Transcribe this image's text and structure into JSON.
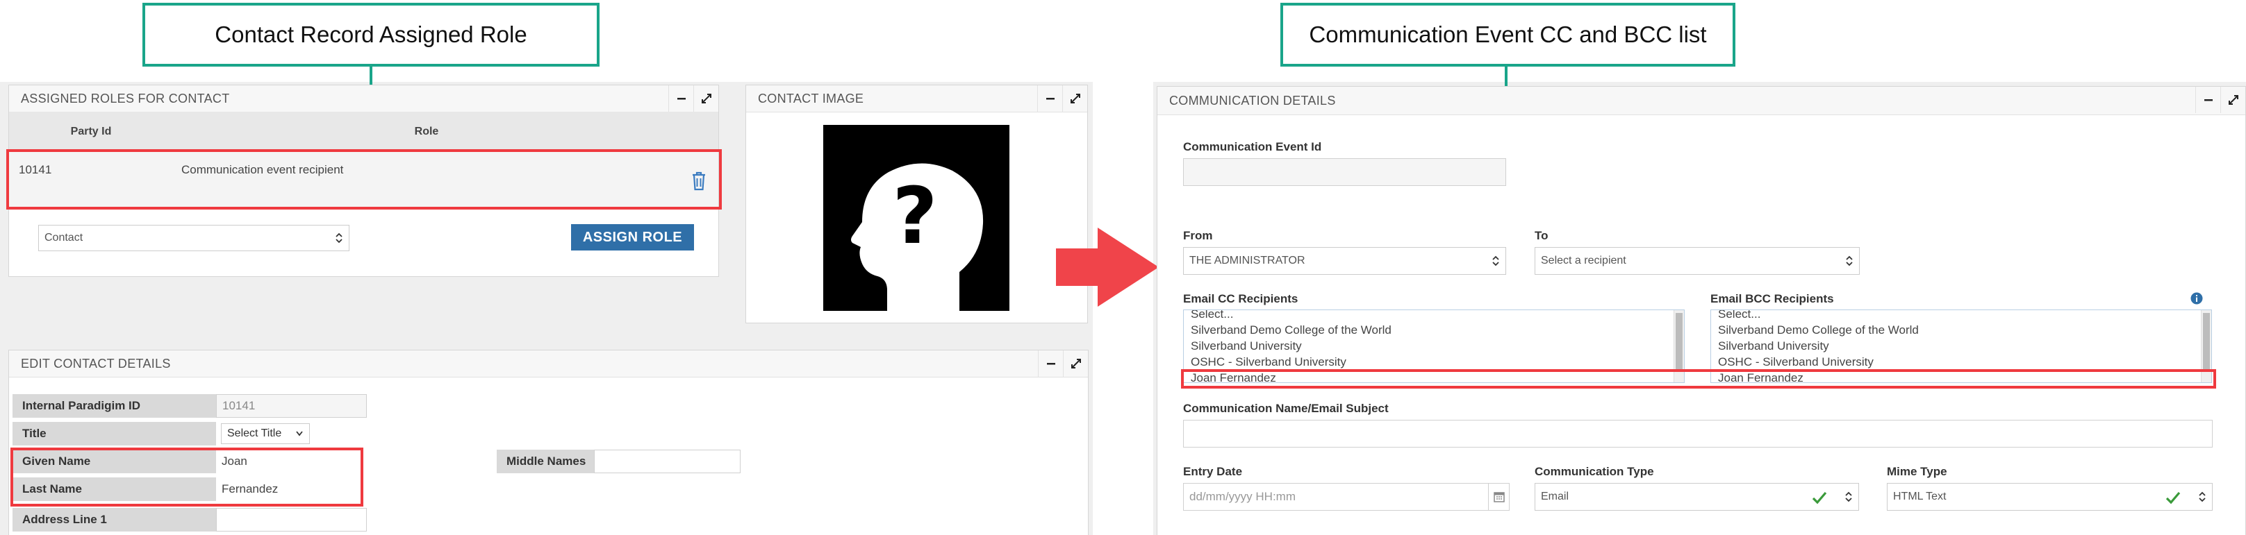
{
  "annotations": {
    "left_callout": "Contact Record Assigned Role",
    "right_callout": "Communication Event CC and BCC list"
  },
  "assigned_roles": {
    "title": "ASSIGNED ROLES FOR CONTACT",
    "columns": [
      "Party Id",
      "Role"
    ],
    "rows": [
      {
        "party_id": "10141",
        "role": "Communication event recipient"
      }
    ],
    "role_type_select": "Contact",
    "assign_button": "ASSIGN ROLE"
  },
  "contact_image": {
    "title": "CONTACT IMAGE"
  },
  "edit_contact": {
    "title": "EDIT CONTACT DETAILS",
    "fields": {
      "internal_id": {
        "label": "Internal Paradigim ID",
        "value": "10141"
      },
      "title": {
        "label": "Title",
        "value": "Select Title"
      },
      "given_name": {
        "label": "Given Name",
        "value": "Joan"
      },
      "last_name": {
        "label": "Last Name",
        "value": "Fernandez"
      },
      "address_line1": {
        "label": "Address Line 1",
        "value": ""
      },
      "middle_names": {
        "label": "Middle Names",
        "value": ""
      }
    }
  },
  "communication": {
    "title": "COMMUNICATION DETAILS",
    "event_id_label": "Communication Event Id",
    "event_id_value": "",
    "from_label": "From",
    "from_value": "THE ADMINISTRATOR",
    "to_label": "To",
    "to_value": "Select a recipient",
    "cc_label": "Email CC Recipients",
    "bcc_label": "Email BCC Recipients",
    "recipients": [
      "Select...",
      "Silverband Demo College of the World",
      "Silverband University",
      "OSHC - Silverband University",
      "Joan Fernandez"
    ],
    "subject_label": "Communication Name/Email Subject",
    "subject_value": "",
    "entry_date_label": "Entry Date",
    "entry_date_placeholder": "dd/mm/yyyy HH:mm",
    "comm_type_label": "Communication Type",
    "comm_type_value": "Email",
    "mime_type_label": "Mime Type",
    "mime_type_value": "HTML Text"
  },
  "colors": {
    "callout_border": "#1aa58a",
    "highlight": "#ef3a3f",
    "primary_button": "#2f6fa8",
    "arrow": "#f0444a",
    "check": "#3a9a3a"
  }
}
